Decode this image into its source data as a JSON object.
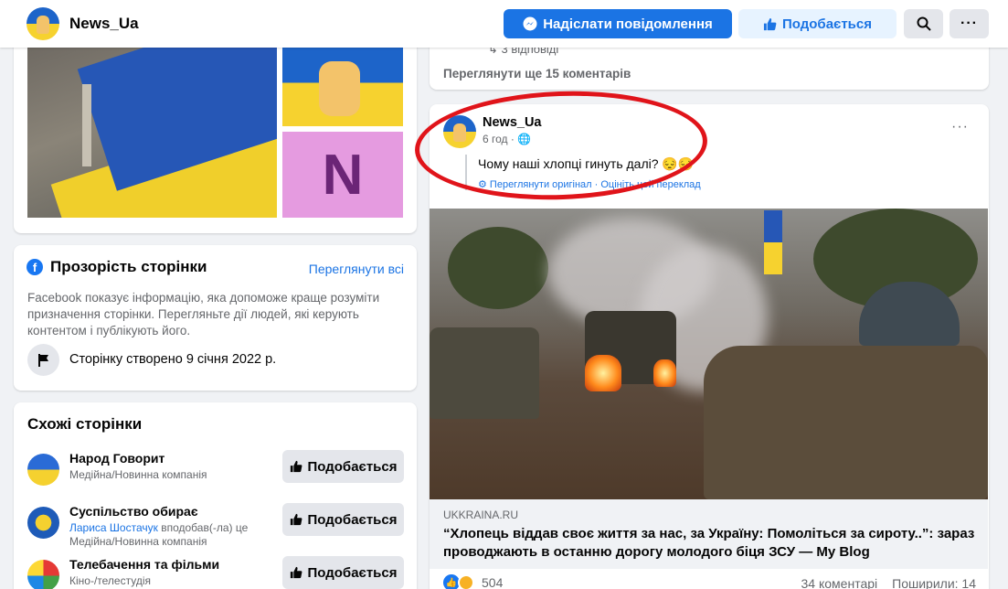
{
  "header": {
    "page_name": "News_Ua",
    "message_button": "Надіслати повідомлення",
    "like_button": "Подобається",
    "more_button": "···"
  },
  "photos": {
    "tile_letter": "N"
  },
  "transparency": {
    "title": "Прозорість сторінки",
    "see_all": "Переглянути всі",
    "description": "Facebook показує інформацію, яка допоможе краще розуміти призначення сторінки. Перегляньте дії людей, які керують контентом і публікують його.",
    "created": "Сторінку створено 9 січня 2022 р."
  },
  "similar": {
    "title": "Схожі сторінки",
    "items": [
      {
        "name": "Народ Говорит",
        "sub1": "Медійна/Новинна компанія",
        "sub_link": "",
        "sub2": "",
        "like": "Подобається"
      },
      {
        "name": "Суспільство обирає",
        "sub_link": "Лариса Шостачук",
        "sub1": " вподобав(-ла) це",
        "sub2": "Медійна/Новинна компанія",
        "like": "Подобається"
      },
      {
        "name": "Телебачення та фільми",
        "sub1": "Кіно-/телестудія",
        "sub_link": "",
        "sub2": "",
        "like": "Подобається"
      }
    ]
  },
  "prev_post": {
    "replies": "↳ 3 відповіді",
    "more_comments": "Переглянути ще 15 коментарів"
  },
  "post": {
    "author": "News_Ua",
    "time": "6 год · ",
    "text": "Чому наші хлопці гинуть далі? 😔😔",
    "translate_original": "Переглянути оригінал",
    "translate_sep": " · ",
    "translate_rate": "Оцініть цей переклад",
    "more": "···",
    "link_domain": "UKKRAINA.RU",
    "link_title": "“Хлопець віддав своє життя за нас, за Україну: Помоліться за сироту..”: зараз проводжають в останню дорогу молодого біця ЗСУ — My Blog",
    "reaction_count": "504",
    "comments": "34 коментарі",
    "shares": "Поширили: 14"
  },
  "colors": {
    "accent": "#1b74e4",
    "annotation": "#e0141a"
  }
}
